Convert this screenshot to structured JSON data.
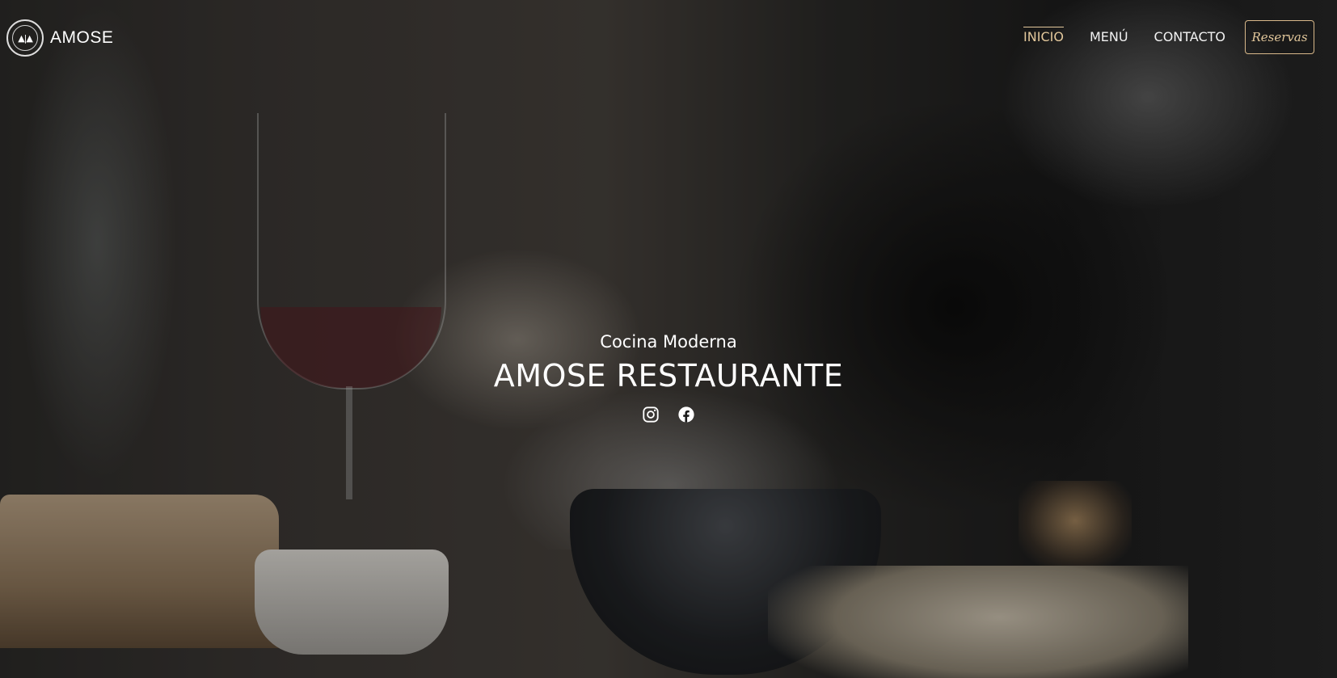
{
  "brand": {
    "logo_glyph": "▲|▲",
    "name": "AMOSE"
  },
  "nav": {
    "items": [
      {
        "label": "INICIO",
        "active": true
      },
      {
        "label": "MENÚ",
        "active": false
      },
      {
        "label": "CONTACTO",
        "active": false
      }
    ],
    "cta_label": "Reservas"
  },
  "hero": {
    "subtitle": "Cocina Moderna",
    "title": "AMOSE RESTAURANTE",
    "social_icons": [
      "instagram-icon",
      "facebook-icon"
    ]
  },
  "colors": {
    "accent": "#e2c79b",
    "text": "#ffffff"
  }
}
